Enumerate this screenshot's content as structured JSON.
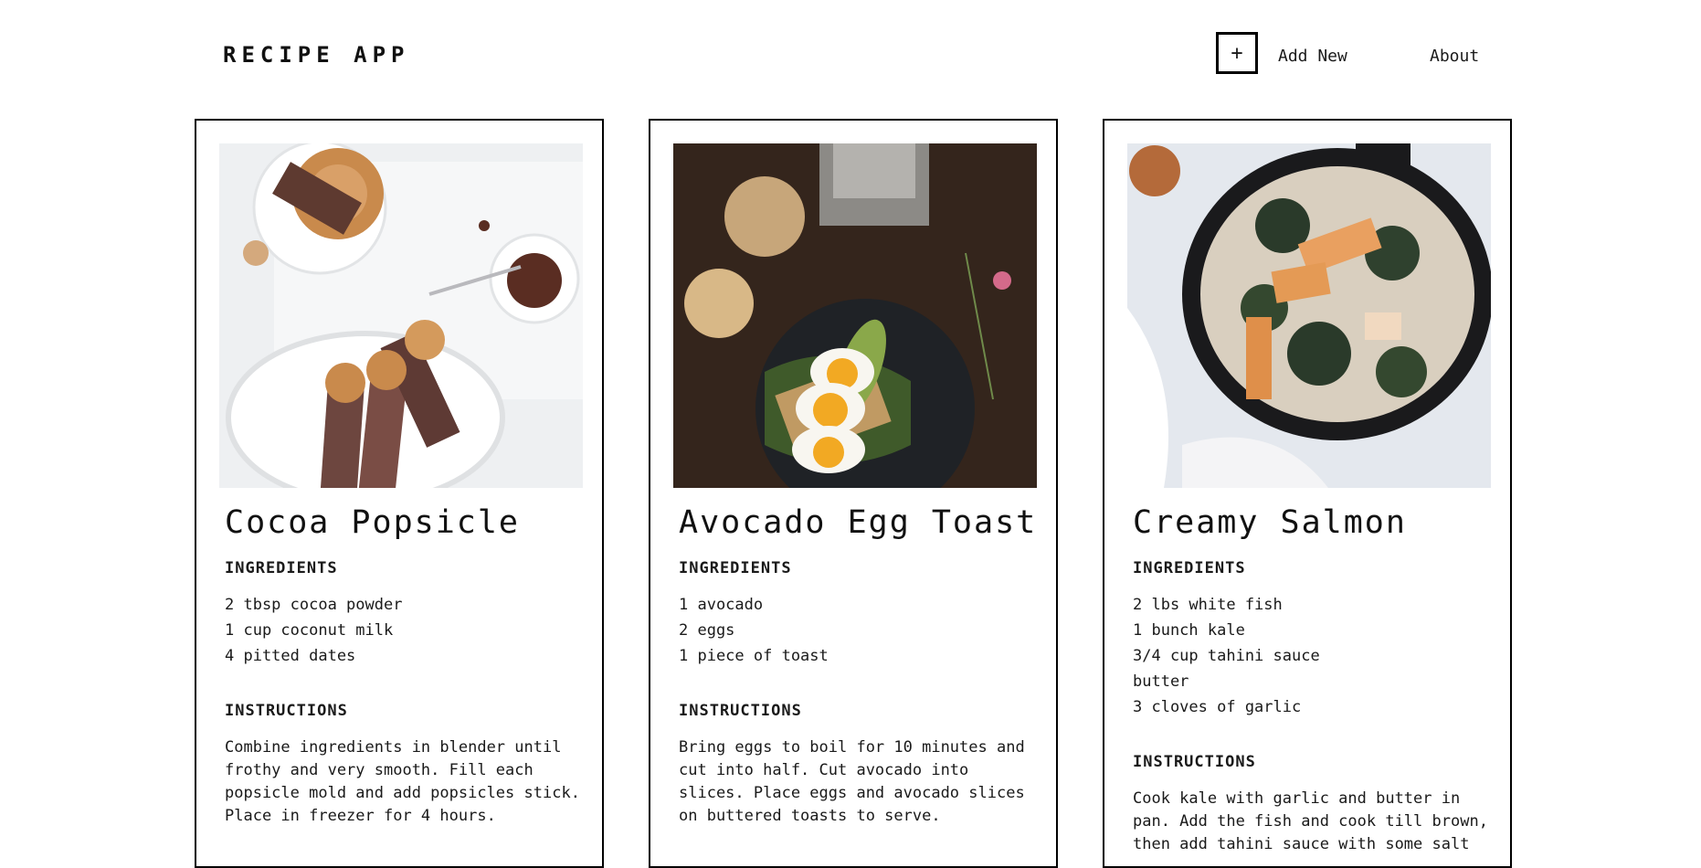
{
  "header": {
    "brand": "RECIPE APP",
    "add_button": "+",
    "add_label": "Add New",
    "about_label": "About"
  },
  "labels": {
    "ingredients": "INGREDIENTS",
    "instructions": "INSTRUCTIONS"
  },
  "recipes": [
    {
      "title": "Cocoa Popsicle",
      "image": "cocoa-popsicle-photo",
      "ingredients": [
        "2 tbsp cocoa powder",
        "1 cup coconut milk",
        "4 pitted dates"
      ],
      "instructions": "Combine ingredients in blender until frothy and very smooth. Fill each popsicle mold and add popsicles stick. Place in freezer for 4 hours."
    },
    {
      "title": "Avocado Egg Toast",
      "image": "avocado-egg-toast-photo",
      "ingredients": [
        "1 avocado",
        "2 eggs",
        "1 piece of toast"
      ],
      "instructions": "Bring eggs to boil for 10 minutes and cut into half. Cut avocado into slices. Place eggs and avocado slices on buttered toasts to serve."
    },
    {
      "title": "Creamy Salmon",
      "image": "creamy-salmon-photo",
      "ingredients": [
        "2 lbs white fish",
        "1 bunch kale",
        "3/4 cup tahini sauce",
        "butter",
        "3 cloves of garlic"
      ],
      "instructions": "Cook kale with garlic and butter in pan. Add the fish and cook till brown, then add tahini sauce with some salt"
    }
  ]
}
